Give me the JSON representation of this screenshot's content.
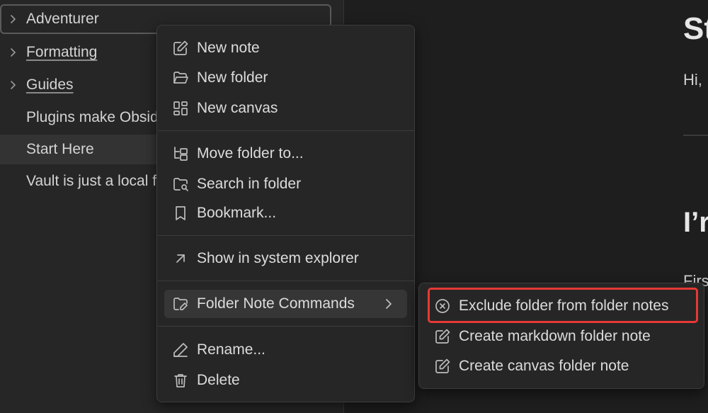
{
  "sidebar": {
    "items": [
      {
        "label": "Adventurer",
        "chevron": true,
        "underline": false
      },
      {
        "label": "Formatting",
        "chevron": true,
        "underline": true
      },
      {
        "label": "Guides",
        "chevron": true,
        "underline": true
      },
      {
        "label": "Plugins make Obsidian",
        "chevron": false,
        "underline": false
      },
      {
        "label": "Start Here",
        "chevron": false,
        "underline": false
      },
      {
        "label": "Vault is just a local folder",
        "chevron": false,
        "underline": false
      }
    ]
  },
  "editor": {
    "heading1": "St",
    "paragraph1": "Hi,",
    "heading2": "I’r",
    "paragraph2": "Firs"
  },
  "context_menu": {
    "items": [
      {
        "label": "New note",
        "icon": "edit-icon"
      },
      {
        "label": "New folder",
        "icon": "folder-open-icon"
      },
      {
        "label": "New canvas",
        "icon": "layout-grid-icon"
      },
      {
        "label": "Move folder to...",
        "icon": "folder-tree-icon"
      },
      {
        "label": "Search in folder",
        "icon": "folder-search-icon"
      },
      {
        "label": "Bookmark...",
        "icon": "bookmark-icon"
      },
      {
        "label": "Show in system explorer",
        "icon": "arrow-up-right-icon"
      },
      {
        "label": "Folder Note Commands",
        "icon": "folder-edit-icon"
      },
      {
        "label": "Rename...",
        "icon": "pencil-icon"
      },
      {
        "label": "Delete",
        "icon": "trash-icon"
      }
    ]
  },
  "submenu": {
    "items": [
      {
        "label": "Exclude folder from folder notes",
        "icon": "x-circle-icon"
      },
      {
        "label": "Create markdown folder note",
        "icon": "edit-icon"
      },
      {
        "label": "Create canvas folder note",
        "icon": "edit-icon"
      }
    ]
  },
  "colors": {
    "highlight_border": "#e53935",
    "background": "#1e1e1e",
    "sidebar_bg": "#262626"
  }
}
